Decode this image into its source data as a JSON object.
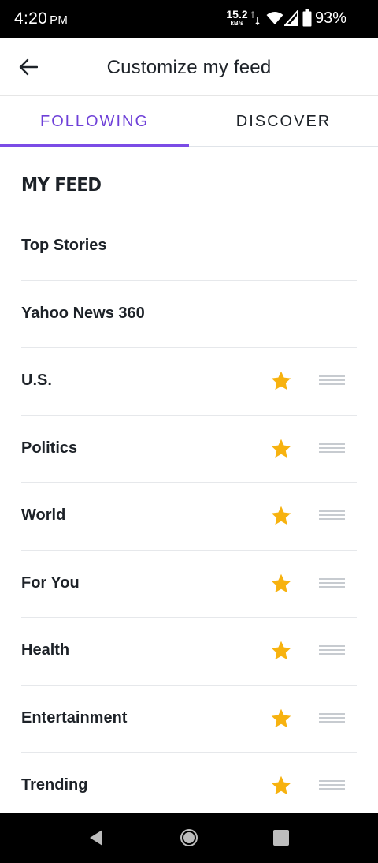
{
  "status_bar": {
    "time": "4:20",
    "ampm": "PM",
    "net_speed": "15.2",
    "net_unit": "kB/s",
    "battery": "93%"
  },
  "app_bar": {
    "title": "Customize my feed",
    "back_icon": "arrow-left-icon"
  },
  "tabs": [
    {
      "label": "FOLLOWING",
      "active": true
    },
    {
      "label": "DISCOVER",
      "active": false
    }
  ],
  "section": {
    "title": "MY FEED"
  },
  "feed_items": [
    {
      "label": "Top Stories",
      "starred": false,
      "draggable": false
    },
    {
      "label": "Yahoo News 360",
      "starred": false,
      "draggable": false
    },
    {
      "label": "U.S.",
      "starred": true,
      "draggable": true
    },
    {
      "label": "Politics",
      "starred": true,
      "draggable": true
    },
    {
      "label": "World",
      "starred": true,
      "draggable": true
    },
    {
      "label": "For You",
      "starred": true,
      "draggable": true
    },
    {
      "label": "Health",
      "starred": true,
      "draggable": true
    },
    {
      "label": "Entertainment",
      "starred": true,
      "draggable": true
    },
    {
      "label": "Trending",
      "starred": true,
      "draggable": true
    }
  ],
  "colors": {
    "accent": "#6e40d8",
    "star": "#f7b20f",
    "text": "#1d2228",
    "divider": "#e6e8eb"
  }
}
